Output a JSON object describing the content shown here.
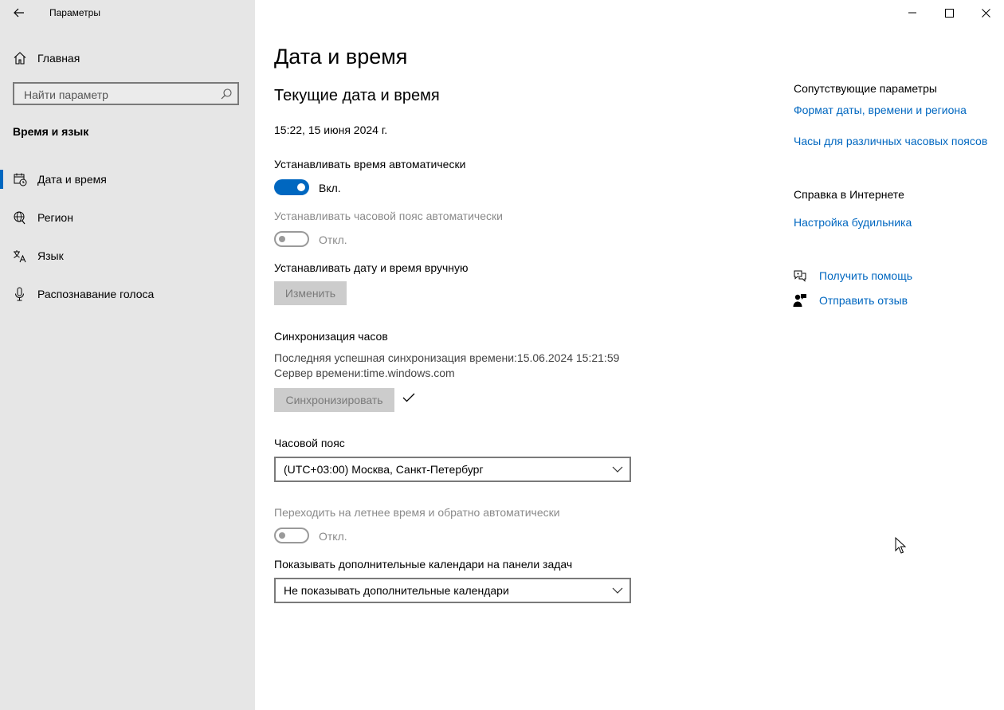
{
  "window": {
    "title": "Параметры"
  },
  "sidebar": {
    "home_label": "Главная",
    "search_placeholder": "Найти параметр",
    "section_title": "Время и язык",
    "items": [
      {
        "label": "Дата и время",
        "icon": "calendar-clock-icon",
        "selected": true
      },
      {
        "label": "Регион",
        "icon": "globe-icon",
        "selected": false
      },
      {
        "label": "Язык",
        "icon": "language-icon",
        "selected": false
      },
      {
        "label": "Распознавание голоса",
        "icon": "microphone-icon",
        "selected": false
      }
    ]
  },
  "main": {
    "title": "Дата и время",
    "current_section_title": "Текущие дата и время",
    "current_datetime": "15:22, 15 июня 2024 г.",
    "auto_time": {
      "label": "Устанавливать время автоматически",
      "state": "on",
      "state_label": "Вкл."
    },
    "auto_timezone": {
      "label": "Устанавливать часовой пояс автоматически",
      "state": "off",
      "state_label": "Откл."
    },
    "manual": {
      "label": "Устанавливать дату и время вручную",
      "button": "Изменить"
    },
    "sync": {
      "title": "Синхронизация часов",
      "last_sync": "Последняя успешная синхронизация времени:15.06.2024 15:21:59",
      "server": "Сервер времени:time.windows.com",
      "button": "Синхронизировать"
    },
    "timezone": {
      "label": "Часовой пояс",
      "value": "(UTC+03:00) Москва, Санкт-Петербург"
    },
    "dst": {
      "label": "Переходить на летнее время и обратно автоматически",
      "state": "off",
      "state_label": "Откл."
    },
    "calendars": {
      "label": "Показывать дополнительные календари на панели задач",
      "value": "Не показывать дополнительные календари"
    }
  },
  "related": {
    "title": "Сопутствующие параметры",
    "links": [
      "Формат даты, времени и региона",
      "Часы для различных часовых поясов"
    ],
    "help_title": "Справка в Интернете",
    "help_links": [
      "Настройка будильника"
    ],
    "get_help": "Получить помощь",
    "feedback": "Отправить отзыв"
  },
  "colors": {
    "accent": "#0067c0",
    "sidebar_bg": "#e6e6e6",
    "disabled_text": "#8a8a8a"
  }
}
